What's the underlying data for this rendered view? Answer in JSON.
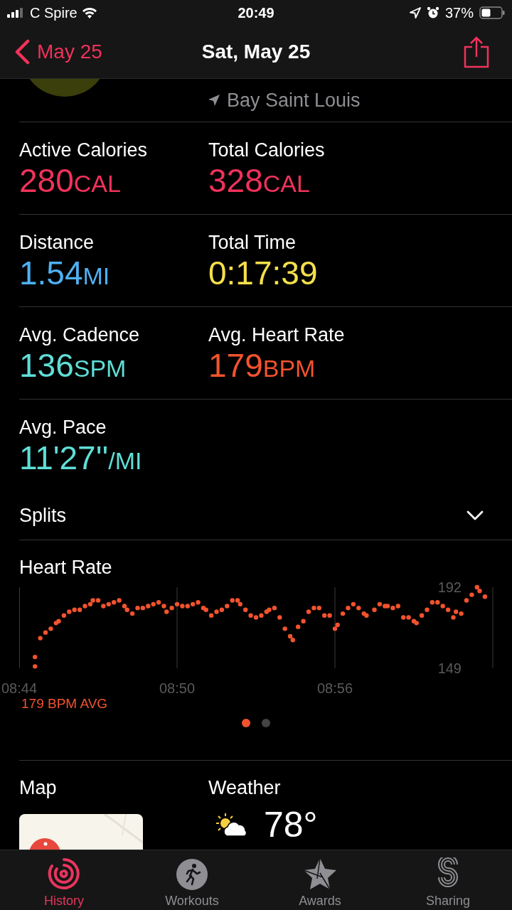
{
  "status_bar": {
    "carrier": "C Spire",
    "time": "20:49",
    "battery": "37%"
  },
  "nav": {
    "back": "May 25",
    "title": "Sat, May 25"
  },
  "location": "Bay Saint Louis",
  "metrics": [
    {
      "label": "Active Calories",
      "value": "280",
      "unit": "CAL",
      "color": "#f0325a"
    },
    {
      "label": "Total Calories",
      "value": "328",
      "unit": "CAL",
      "color": "#f0325a"
    },
    {
      "label": "Distance",
      "value": "1.54",
      "unit": "MI",
      "color": "#4fb0f2"
    },
    {
      "label": "Total Time",
      "value": "0:17:39",
      "color": "#f6e04b"
    },
    {
      "label": "Avg. Cadence",
      "value": "136",
      "unit": "SPM",
      "color": "#5fded6"
    },
    {
      "label": "Avg. Heart Rate",
      "value": "179",
      "unit": "BPM",
      "color": "#f2532e"
    },
    {
      "label": "Avg. Pace",
      "value": "11'27''",
      "unit": "/MI",
      "color": "#5fded6"
    }
  ],
  "splits": {
    "label": "Splits",
    "expanded": false
  },
  "heart_rate": {
    "average": "179 BPM AVG",
    "chart_data": {
      "type": "scatter",
      "xlim": [
        524,
        542
      ],
      "ylim": [
        149,
        192
      ],
      "xticks": [
        {
          "value": 524,
          "label": "08:44"
        },
        {
          "value": 530,
          "label": "08:50"
        },
        {
          "value": 536,
          "label": "08:56"
        }
      ],
      "yticks": [
        149,
        192
      ],
      "series": [
        {
          "name": "Heart Rate",
          "color": "#f2532e",
          "x": [
            524.6,
            524.6,
            524.8,
            525.0,
            525.2,
            525.4,
            525.5,
            525.7,
            525.9,
            526.1,
            526.3,
            526.5,
            526.7,
            526.8,
            527.0,
            527.2,
            527.4,
            527.6,
            527.8,
            528.0,
            528.1,
            528.3,
            528.5,
            528.7,
            528.9,
            529.1,
            529.3,
            529.5,
            529.6,
            529.8,
            530.0,
            530.2,
            530.4,
            530.6,
            530.8,
            531.0,
            531.1,
            531.3,
            531.5,
            531.7,
            531.9,
            532.1,
            532.3,
            532.4,
            532.6,
            532.8,
            533.0,
            533.2,
            533.4,
            533.5,
            533.7,
            533.9,
            534.1,
            534.3,
            534.4,
            534.6,
            534.8,
            535.0,
            535.2,
            535.4,
            535.6,
            535.8,
            536.0,
            536.1,
            536.3,
            536.5,
            536.7,
            536.9,
            537.1,
            537.2,
            537.5,
            537.7,
            537.9,
            538.0,
            538.2,
            538.4,
            538.6,
            538.8,
            539.0,
            539.1,
            539.3,
            539.5,
            539.7,
            539.9,
            540.1,
            540.3,
            540.5,
            540.6,
            540.8,
            541.0,
            541.2,
            541.4,
            541.5,
            541.7
          ],
          "values": [
            150,
            155,
            165,
            168,
            170,
            173,
            174,
            177,
            179,
            180,
            180,
            182,
            183,
            185,
            185,
            182,
            183,
            184,
            185,
            182,
            180,
            178,
            181,
            181,
            182,
            183,
            184,
            182,
            179,
            181,
            183,
            182,
            182,
            183,
            184,
            181,
            180,
            177,
            179,
            180,
            182,
            185,
            185,
            183,
            180,
            177,
            176,
            177,
            179,
            180,
            181,
            176,
            170,
            166,
            164,
            171,
            174,
            179,
            181,
            181,
            177,
            177,
            170,
            172,
            178,
            181,
            183,
            181,
            178,
            177,
            180,
            183,
            182,
            182,
            181,
            182,
            176,
            176,
            174,
            173,
            177,
            180,
            184,
            184,
            182,
            180,
            176,
            179,
            178,
            185,
            188,
            192,
            190,
            187
          ]
        }
      ]
    }
  },
  "pager": [
    {
      "selected": true
    },
    {
      "selected": false
    }
  ],
  "map": {
    "title": "Map"
  },
  "weather": {
    "title": "Weather",
    "temperature": "78°"
  },
  "tabs": [
    {
      "label": "History",
      "selected": true,
      "kind": "history"
    },
    {
      "label": "Workouts",
      "selected": false,
      "kind": "workouts"
    },
    {
      "label": "Awards",
      "selected": false,
      "kind": "awards"
    },
    {
      "label": "Sharing",
      "selected": false,
      "kind": "sharing"
    }
  ]
}
